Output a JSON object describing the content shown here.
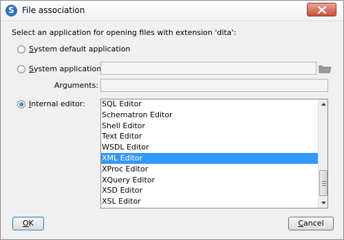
{
  "window": {
    "title": "File association",
    "app_icon": "S",
    "close_icon": "close-icon"
  },
  "prompt": "Select an application for opening files with extension 'dita':",
  "options": {
    "system_default": {
      "mnemonic": "S",
      "rest": "ystem default application",
      "selected": false
    },
    "system_application": {
      "mnemonic": "S",
      "rest": "ystem application:",
      "selected": false
    },
    "internal_editor": {
      "mnemonic": "I",
      "rest": "nternal editor:",
      "selected": true
    }
  },
  "system_application_field": {
    "value": "",
    "enabled": false
  },
  "arguments": {
    "label": "Arguments:",
    "value": "",
    "enabled": false
  },
  "editor_list": {
    "items": [
      "SQL Editor",
      "Schematron Editor",
      "Shell Editor",
      "Text Editor",
      "WSDL Editor",
      "XML Editor",
      "XProc Editor",
      "XQuery Editor",
      "XSD Editor",
      "XSL Editor"
    ],
    "selected": "XML Editor"
  },
  "buttons": {
    "ok": {
      "mnemonic": "O",
      "rest": "K"
    },
    "cancel": {
      "mnemonic": "C",
      "rest": "ancel"
    }
  },
  "colors": {
    "selection": "#3399ff",
    "radio_selected": "#1d4f9a",
    "close_button": "#c7503a"
  }
}
